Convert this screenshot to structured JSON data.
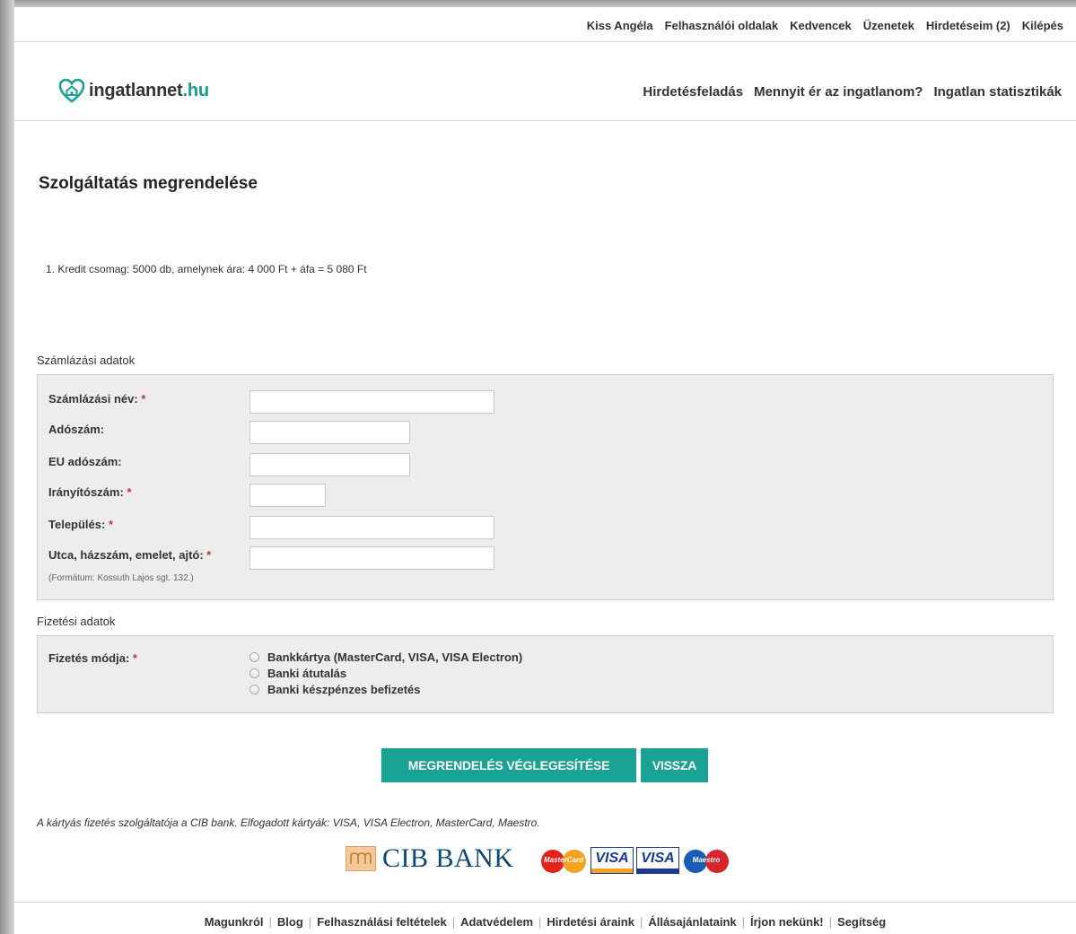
{
  "userbar": {
    "items": [
      "Kiss Angéla",
      "Felhasználói oldalak",
      "Kedvencek",
      "Üzenetek",
      "Hirdetéseim (2)",
      "Kilépés"
    ]
  },
  "logo": {
    "name": "ingatlannet",
    "tld": ".hu"
  },
  "mainnav": {
    "items": [
      "Hirdetésfeladás",
      "Mennyit ér az ingatlanom?",
      "Ingatlan statisztikák"
    ]
  },
  "page": {
    "title": "Szolgáltatás megrendelése",
    "order_line": "1. Kredit csomag: 5000 db, amelynek ára: 4 000 Ft + áfa = 5 080 Ft"
  },
  "billing": {
    "label": "Számlázási adatok",
    "fields": [
      {
        "label": "Számlázási név:",
        "required": "*",
        "value": ""
      },
      {
        "label": "Adószám:",
        "required": "",
        "value": ""
      },
      {
        "label": "EU adószám:",
        "required": "",
        "value": ""
      },
      {
        "label": "Irányítószám:",
        "required": "*",
        "value": ""
      },
      {
        "label": "Település:",
        "required": "*",
        "value": ""
      },
      {
        "label": "Utca, házszám, emelet, ajtó:",
        "required": "*",
        "value": ""
      }
    ],
    "hint": "(Formátum: Kossuth Lajos sgt. 132.)"
  },
  "payment": {
    "label": "Fizetési adatok",
    "method_label": "Fizetés módja:",
    "required": "*",
    "options": [
      "Bankkártya (MasterCard, VISA, VISA Electron)",
      "Banki átutalás",
      "Banki készpénzes befizetés"
    ]
  },
  "buttons": {
    "finalize": "MEGRENDELÉS VÉGLEGESÍTÉSE",
    "back": "VISSZA"
  },
  "card_note": "A kártyás fizetés szolgáltatója a CIB bank. Elfogadott kártyák: VISA, VISA Electron, MasterCard, Maestro.",
  "logos": {
    "cib_text": "CIB BANK",
    "mastercard": "MasterCard",
    "visa": "VISA",
    "visa_electron": "VISA",
    "maestro": "Maestro"
  },
  "footer": {
    "items": [
      "Magunkról",
      "Blog",
      "Felhasználási feltételek",
      "Adatvédelem",
      "Hirdetési áraink",
      "Állásajánlataink",
      "Írjon nekünk!",
      "Segítség"
    ]
  },
  "colors": {
    "accent": "#1aa394",
    "required": "#c0392b",
    "box_bg": "#ededed"
  }
}
